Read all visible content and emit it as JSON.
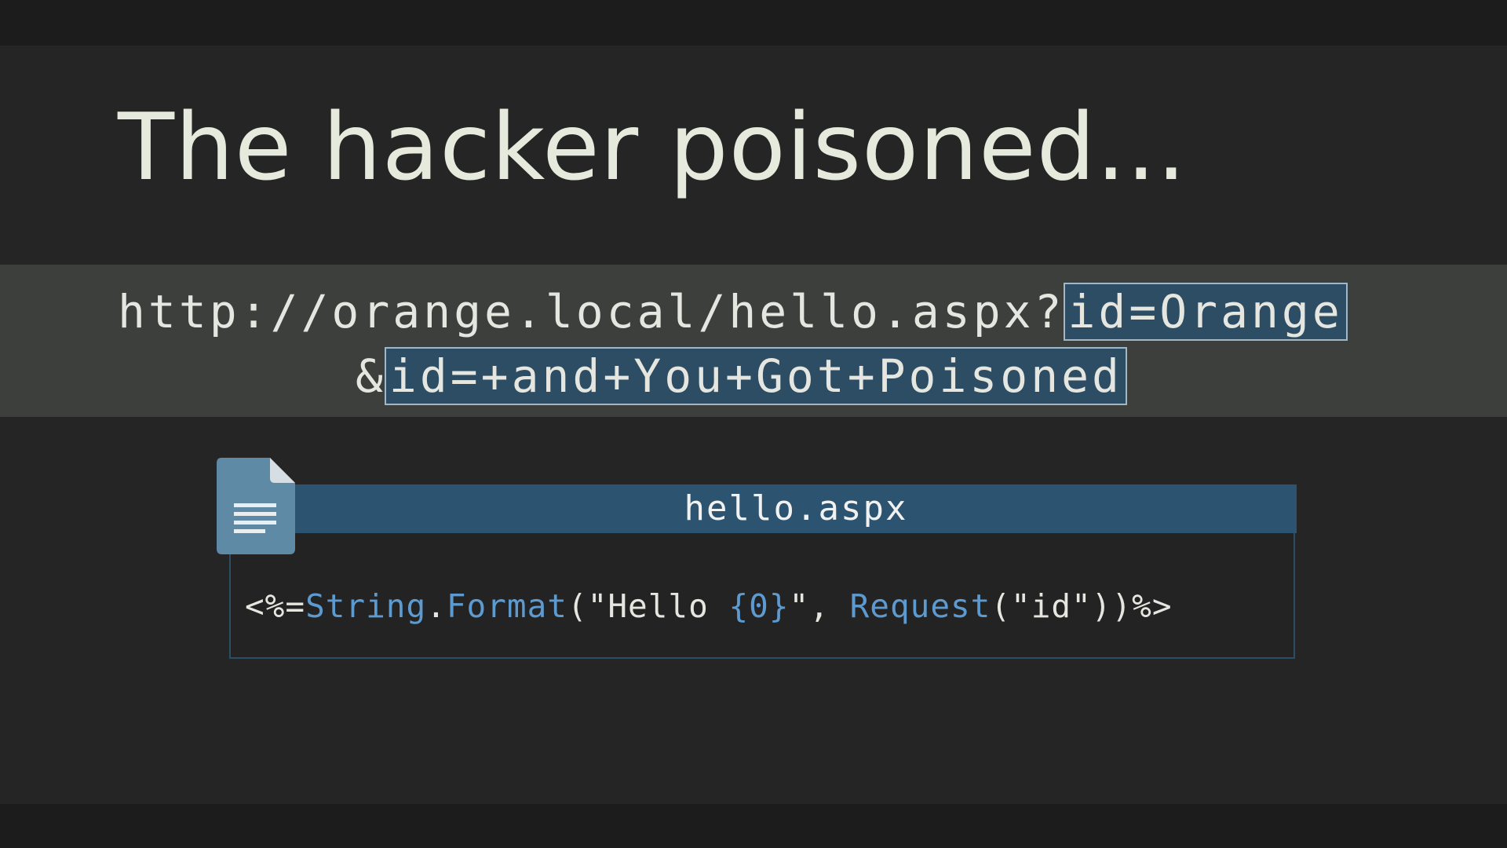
{
  "slide": {
    "title": "The hacker poisoned..."
  },
  "url": {
    "line1_prefix": "http://orange.local/hello.aspx?",
    "line1_highlight": "id=Orange",
    "line2_prefix": "&",
    "line2_highlight": "id=+and+You+Got+Poisoned"
  },
  "file": {
    "icon": "document-icon",
    "name": "hello.aspx",
    "code": {
      "t1": "<%=",
      "t2": "String",
      "t3": ".",
      "t4": "Format",
      "t5": "(\"Hello ",
      "t6": "{0}",
      "t7": "\", ",
      "t8": "Request",
      "t9": "(\"id\"))%>"
    }
  },
  "colors": {
    "background": "#252525",
    "url_band": "#3d3f3d",
    "highlight": "#2c4d63",
    "file_header": "#2c5470",
    "code_keyword": "#5d9ad0",
    "text": "#e6eadc"
  }
}
